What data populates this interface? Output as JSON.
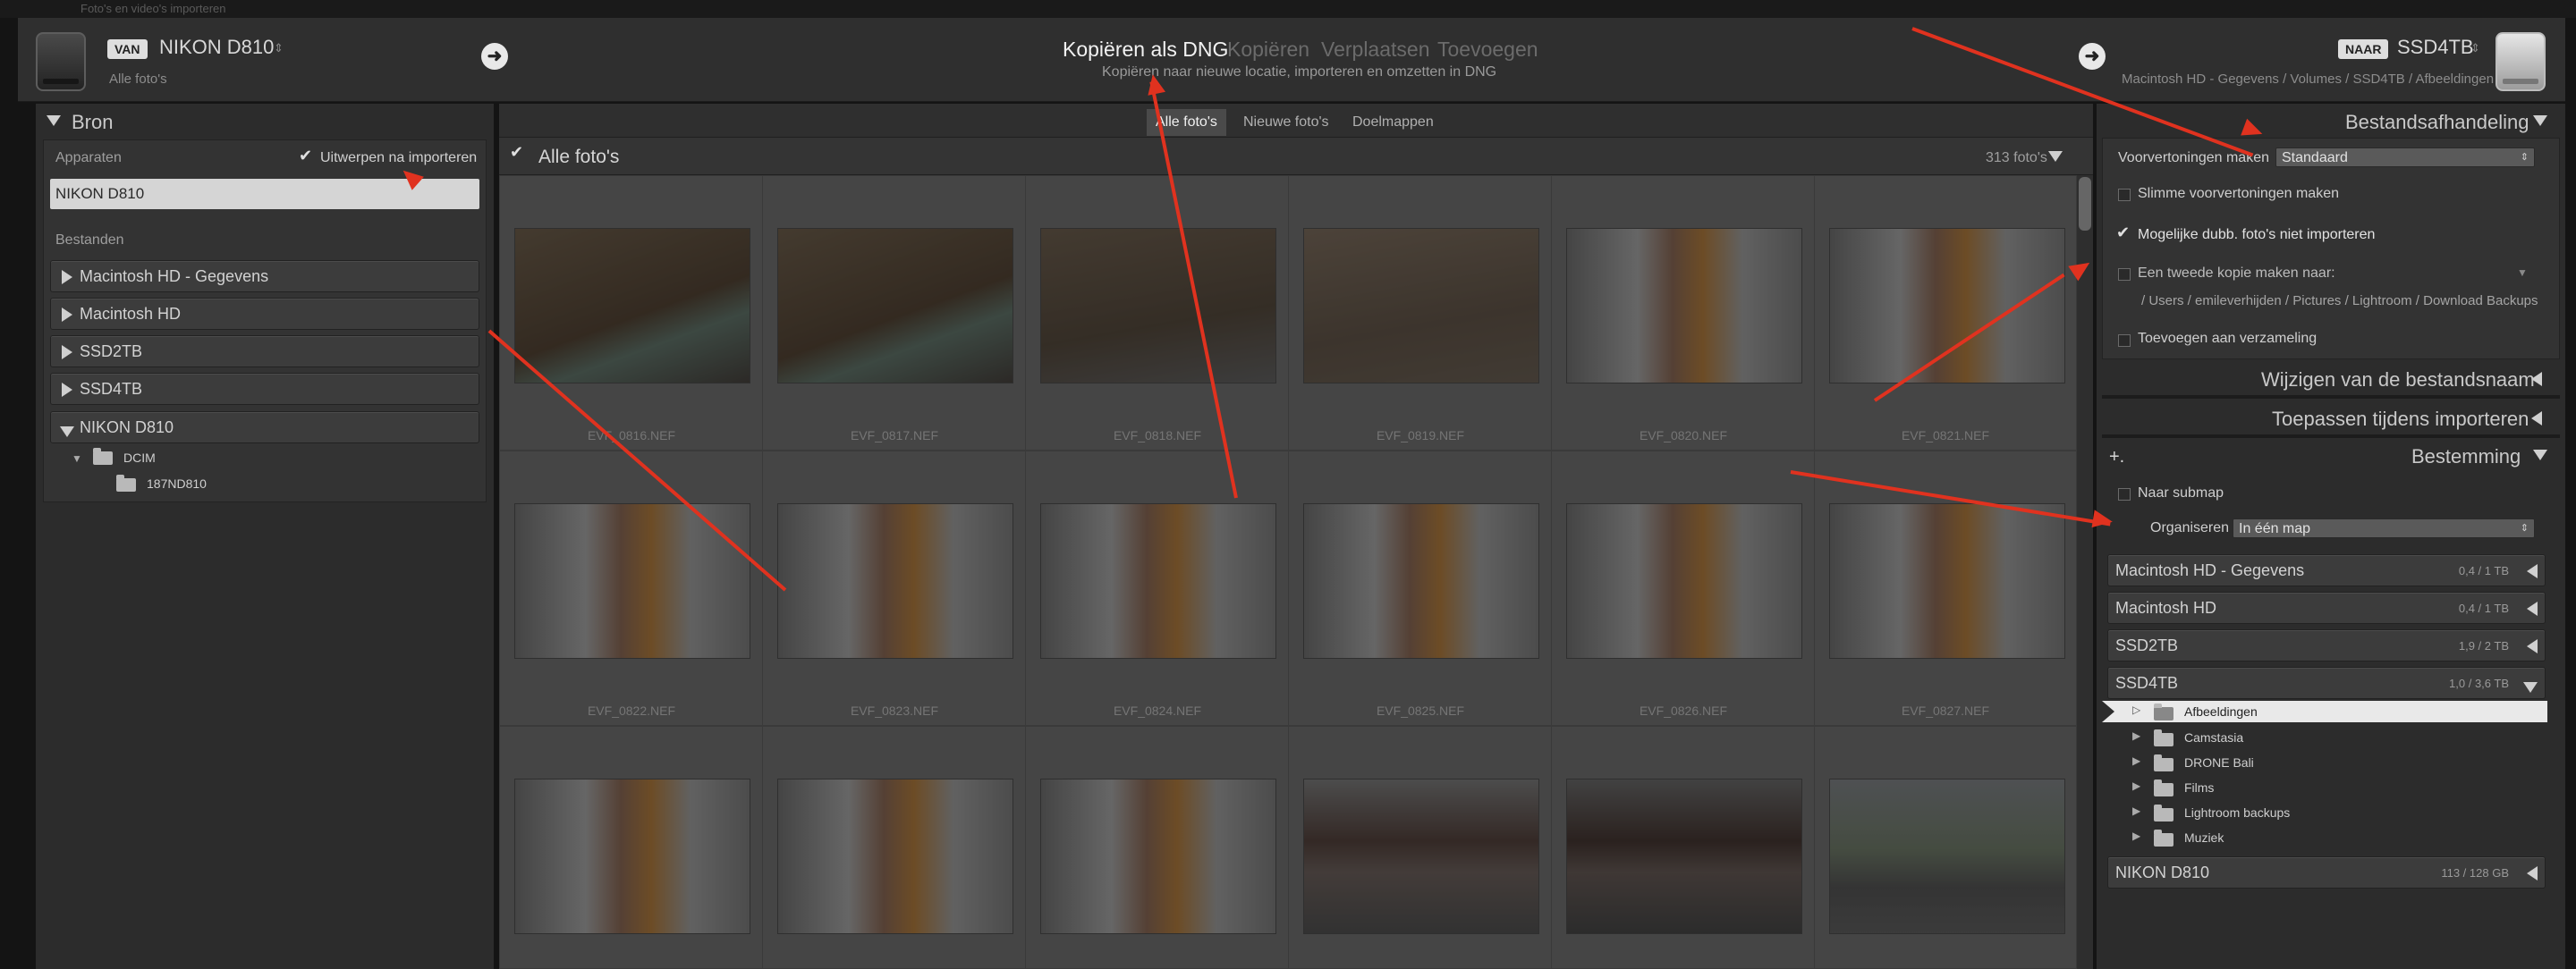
{
  "window": {
    "title": "Foto's en video's importeren"
  },
  "header": {
    "source_badge": "VAN",
    "source_name": "NIKON D810",
    "source_sub": "Alle foto's",
    "modes": [
      {
        "label": "Kopiëren als DNG",
        "active": true
      },
      {
        "label": "Kopiëren",
        "active": false
      },
      {
        "label": "Verplaatsen",
        "active": false
      },
      {
        "label": "Toevoegen",
        "active": false
      }
    ],
    "mode_sub": "Kopiëren naar nieuwe locatie, importeren en omzetten in DNG",
    "dest_badge": "NAAR",
    "dest_name": "SSD4TB",
    "dest_sub": "Macintosh HD - Gegevens / Volumes / SSD4TB / Afbeeldingen",
    "go_icon": "arrow-right-icon"
  },
  "left": {
    "title": "Bron",
    "devices_label": "Apparaten",
    "eject_label": "Uitwerpen na importeren",
    "device": "NIKON D810",
    "files_label": "Bestanden",
    "volumes": [
      "Macintosh HD - Gegevens",
      "Macintosh HD",
      "SSD2TB",
      "SSD4TB",
      "NIKON D810"
    ],
    "folders": [
      "DCIM",
      "187ND810"
    ]
  },
  "center": {
    "tabs": [
      {
        "label": "Alle foto's",
        "active": true
      },
      {
        "label": "Nieuwe foto's",
        "active": false
      },
      {
        "label": "Doelmappen",
        "active": false
      }
    ],
    "grid_title": "Alle foto's",
    "count": "313 foto's",
    "files": [
      "EVF_0816.NEF",
      "EVF_0817.NEF",
      "EVF_0818.NEF",
      "EVF_0819.NEF",
      "EVF_0820.NEF",
      "EVF_0821.NEF",
      "EVF_0822.NEF",
      "EVF_0823.NEF",
      "EVF_0824.NEF",
      "EVF_0825.NEF",
      "EVF_0826.NEF",
      "EVF_0827.NEF",
      "",
      "",
      "",
      "",
      "",
      ""
    ]
  },
  "right": {
    "file_handling": "Bestandsafhandeling",
    "previews_label": "Voorvertoningen maken",
    "previews_value": "Standaard",
    "smart_previews": "Slimme voorvertoningen maken",
    "no_duplicates": "Mogelijke dubb. foto's niet importeren",
    "second_copy": "Een tweede kopie maken naar:",
    "second_copy_path": "/ Users / emileverhijden / Pictures / Lightroom / Download Backups",
    "add_collection": "Toevoegen aan verzameling",
    "rename": "Wijzigen van de bestandsnaam",
    "apply": "Toepassen tijdens importeren",
    "plus": "+.",
    "destination": "Bestemming",
    "into_subfolder": "Naar submap",
    "organize_label": "Organiseren",
    "organize_value": "In één map",
    "volumes": [
      {
        "name": "Macintosh HD - Gegevens",
        "size": "0,4 / 1 TB"
      },
      {
        "name": "Macintosh HD",
        "size": "0,4 / 1 TB"
      },
      {
        "name": "SSD2TB",
        "size": "1,9 / 2 TB"
      },
      {
        "name": "SSD4TB",
        "size": "1,0 / 3,6 TB"
      }
    ],
    "folders": [
      "Afbeeldingen",
      "Camstasia",
      "DRONE Bali",
      "Films",
      "Lightroom backups",
      "Muziek"
    ],
    "last_volume": {
      "name": "NIKON D810",
      "size": "113 / 128 GB"
    }
  },
  "colors": {
    "annotation": "#e0321f",
    "panel": "#2c2c2c",
    "grid": "#3a3a3a"
  }
}
